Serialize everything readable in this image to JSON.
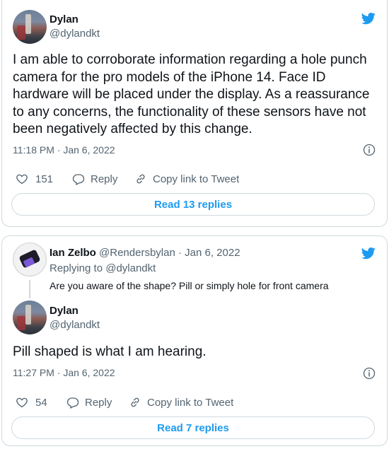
{
  "tweet1": {
    "author_name": "Dylan",
    "author_handle": "@dylandkt",
    "text": "I am able to corroborate information regarding a hole punch camera for the pro models of the iPhone 14. Face ID hardware will be placed under the display. As a reassurance to any concerns, the functionality of these sensors have not been negatively affected by this change.",
    "time": "11:18 PM",
    "separator": " · ",
    "date": "Jan 6, 2022",
    "likes": "151",
    "reply_label": "Reply",
    "copy_label": "Copy link to Tweet",
    "read_replies": "Read 13 replies"
  },
  "tweet2": {
    "parent": {
      "author_name": "Ian Zelbo",
      "author_handle": "@Rendersbylan",
      "separator": " · ",
      "date": "Jan 6, 2022",
      "replying_to": "Replying to @dylandkt",
      "text": "Are you aware of the shape? Pill or simply hole for front camera"
    },
    "author_name": "Dylan",
    "author_handle": "@dylandkt",
    "text": "Pill shaped is what I am hearing.",
    "time": "11:27 PM",
    "separator": " · ",
    "date": "Jan 6, 2022",
    "likes": "54",
    "reply_label": "Reply",
    "copy_label": "Copy link to Tweet",
    "read_replies": "Read 7 replies"
  },
  "colors": {
    "accent": "#1d9bf0",
    "text": "#0f1419",
    "secondary": "#536471",
    "border": "#cfd9de"
  },
  "icons": [
    "twitter-bird-icon",
    "info-icon",
    "heart-icon",
    "reply-bubble-icon",
    "link-icon"
  ]
}
